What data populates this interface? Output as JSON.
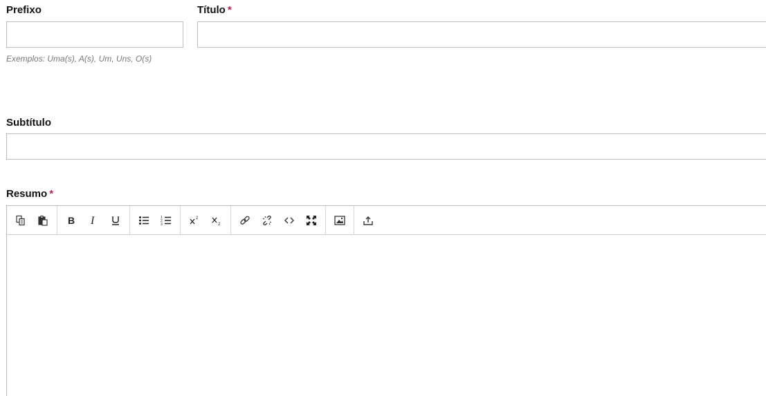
{
  "fields": {
    "prefix": {
      "label": "Prefixo",
      "value": "",
      "hint": "Exemplos: Uma(s), A(s), Um, Uns, O(s)"
    },
    "title": {
      "label": "Título",
      "required_mark": "*",
      "value": ""
    },
    "subtitle": {
      "label": "Subtítulo",
      "value": ""
    },
    "abstract": {
      "label": "Resumo",
      "required_mark": "*",
      "value": ""
    }
  },
  "toolbar": {
    "groups": [
      [
        "copy-icon",
        "paste-icon"
      ],
      [
        "bold-icon",
        "italic-icon",
        "underline-icon"
      ],
      [
        "bullet-list-icon",
        "numbered-list-icon"
      ],
      [
        "superscript-icon",
        "subscript-icon"
      ],
      [
        "link-icon",
        "unlink-icon",
        "code-icon",
        "fullscreen-icon"
      ],
      [
        "image-icon"
      ],
      [
        "upload-icon"
      ]
    ]
  },
  "colors": {
    "required": "#c2185b",
    "border": "#bdbdbd",
    "hint": "#777777"
  }
}
